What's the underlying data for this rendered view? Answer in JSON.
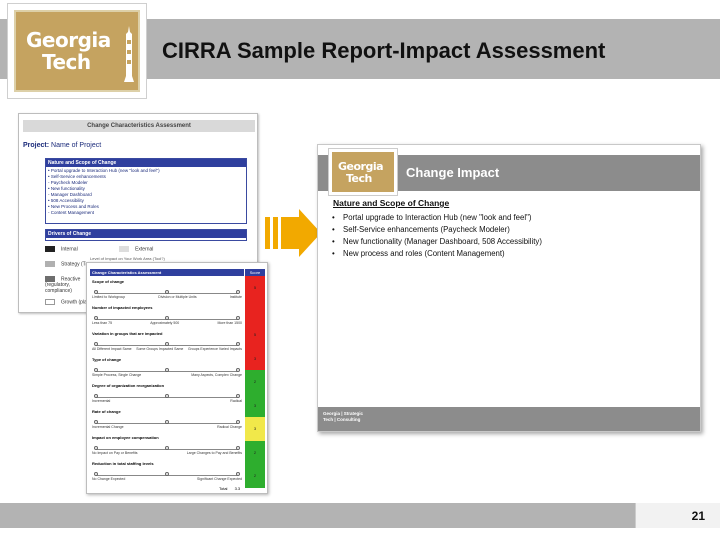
{
  "header": {
    "logo_line1": "Georgia",
    "logo_line2": "Tech",
    "title": "CIRRA Sample Report-Impact Assessment"
  },
  "doc_change_characteristics": {
    "title": "Change Characteristics Assessment",
    "project_label": "Project:",
    "project_name": "Name of Project",
    "scope_heading": "Nature and Scope of Change",
    "scope_items": [
      "• Portal upgrade to Interaction Hub (new \"look and feel\")",
      "• Self-Service enhancements",
      "   - Paycheck Modeler",
      "• New functionality",
      "   - Manager Dashboard",
      "• 508 Accessibility",
      "• New Process and Roles",
      "   - Content Management"
    ],
    "drivers_heading": "Drivers of Change",
    "drivers": [
      {
        "label": "Internal",
        "label2": "External",
        "color": "#222222"
      },
      {
        "label": "Strategy (Tra",
        "label2": "",
        "color": "#b0b0b0"
      },
      {
        "label": "Reactive (regulatory, compliance)",
        "label2": "",
        "color": "#6e6e6e"
      },
      {
        "label": "Growth (plans",
        "label2": "",
        "color": "#ffffff"
      }
    ]
  },
  "doc_change_characteristics_scored": {
    "above_text": "Level of Impact on Your Work Area (Tool?)",
    "title": "Change Characteristics Assessment",
    "score_header": "Score",
    "score_cells": [
      {
        "value": "5",
        "color": "#e8231f"
      },
      {
        "value": "",
        "color": "#e8231f"
      },
      {
        "value": "5",
        "color": "#e8231f"
      },
      {
        "value": "3",
        "color": "#e8231f"
      },
      {
        "value": "2",
        "color": "#2eae2e"
      },
      {
        "value": "3",
        "color": "#2eae2e"
      },
      {
        "value": "3",
        "color": "#f1e84a"
      },
      {
        "value": "2",
        "color": "#2eae2e"
      },
      {
        "value": "2",
        "color": "#2eae2e"
      }
    ],
    "rows": [
      {
        "label": "Scope of change",
        "left": "Limited to Workgroup",
        "mid": "Division or Multiple Units",
        "right": "Institute"
      },
      {
        "label": "Number of impacted employees",
        "left": "Less than 75",
        "mid": "Approximately 500",
        "right": "More than 1500"
      },
      {
        "label": "Variation in groups that are impacted",
        "left": "All Different Impact Same",
        "mid": "Some Groups Impacted Same",
        "right": "Groups Experience Varied Impacts"
      },
      {
        "label": "Type of change",
        "left": "Simple Process, Single Change",
        "mid": "",
        "right": "Many Aspects, Complex Change"
      },
      {
        "label": "Degree of organization reorganization",
        "left": "Incremental",
        "mid": "",
        "right": "Radical"
      },
      {
        "label": "Rate of change",
        "left": "Incremental Change",
        "mid": "",
        "right": "Radical Change"
      },
      {
        "label": "Impact on employee compensation",
        "left": "No Impact on Pay or Benefits",
        "mid": "",
        "right": "Large Changes to Pay and Benefits"
      },
      {
        "label": "Reduction in total staffing levels",
        "left": "No Change Expected",
        "mid": "",
        "right": "Significant Change Expected"
      }
    ],
    "total_label": "Total",
    "total_value": "3.3"
  },
  "slide": {
    "logo_line1": "Georgia",
    "logo_line2": "Tech",
    "title": "Change Impact",
    "subtitle": "Nature and Scope of Change",
    "bullets": [
      "Portal upgrade to Interaction Hub (new \"look and feel\")",
      "Self-Service enhancements (Paycheck Modeler)",
      "New functionality (Manager Dashboard, 508 Accessibility)",
      "New process and roles (Content Management)"
    ],
    "footer_line1": "Georgia | Strategic",
    "footer_line2": "Tech | Consulting"
  },
  "footer": {
    "page_number": "21"
  },
  "colors": {
    "header_band": "#b3b3b3",
    "gt_gold": "#c5a360",
    "arrow": "#f2a900",
    "doc_blue": "#2f3f9e"
  }
}
